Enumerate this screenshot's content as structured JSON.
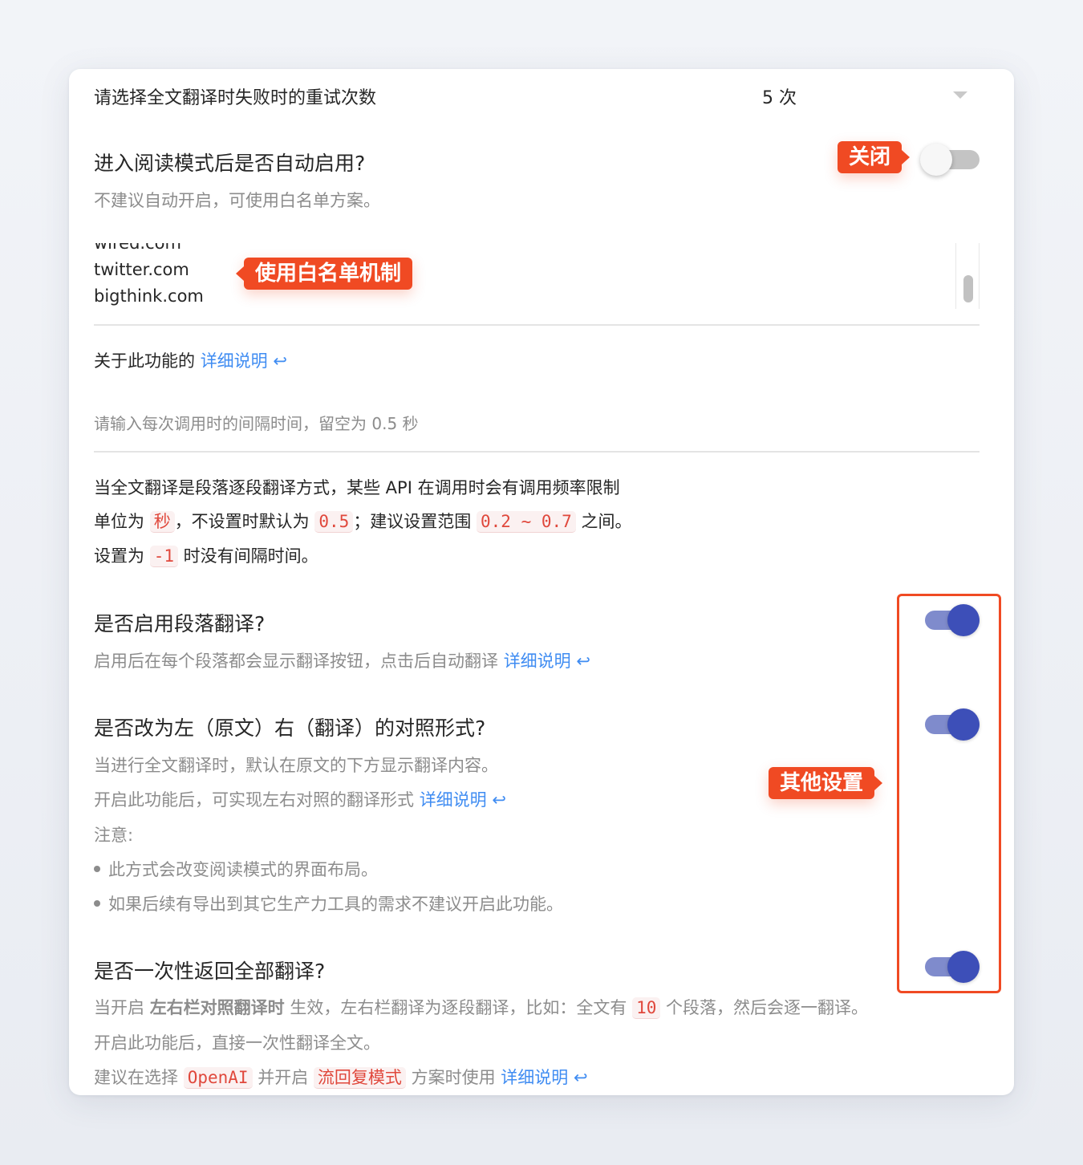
{
  "retry": {
    "label": "请选择全文翻译时失败时的重试次数",
    "value": "5 次"
  },
  "auto_enable": {
    "title": "进入阅读模式后是否自动启用?",
    "desc": "不建议自动开启，可使用白名单方案。",
    "state": "off"
  },
  "whitelist": {
    "items": [
      "wired.com",
      "twitter.com",
      "bigthink.com"
    ]
  },
  "about": {
    "prefix": "关于此功能的",
    "link": "详细说明",
    "arrow": "↩"
  },
  "interval": {
    "placeholder": "请输入每次调用时的间隔时间，留空为 0.5 秒",
    "line1": "当全文翻译是段落逐段翻译方式，某些 API 在调用时会有调用频率限制",
    "line2_a": "单位为",
    "line2_code1": "秒",
    "line2_b": "，不设置时默认为",
    "line2_code2": "0.5",
    "line2_c": "；建议设置范围",
    "line2_code3": "0.2 ~ 0.7",
    "line2_d": "之间。",
    "line3_a": "设置为",
    "line3_code": "-1",
    "line3_b": "时没有间隔时间。"
  },
  "paragraph_translate": {
    "title": "是否启用段落翻译?",
    "desc": "启用后在每个段落都会显示翻译按钮，点击后自动翻译",
    "link": "详细说明",
    "state": "on"
  },
  "side_by_side": {
    "title": "是否改为左（原文）右（翻译）的对照形式?",
    "desc1": "当进行全文翻译时，默认在原文的下方显示翻译内容。",
    "desc2": "开启此功能后，可实现左右对照的翻译形式",
    "link": "详细说明",
    "note_label": "注意:",
    "bullets": [
      "此方式会改变阅读模式的界面布局。",
      "如果后续有导出到其它生产力工具的需求不建议开启此功能。"
    ],
    "state": "on"
  },
  "all_at_once": {
    "title": "是否一次性返回全部翻译?",
    "l1_a": "当开启",
    "l1_bold": "左右栏对照翻译时",
    "l1_b": "生效，左右栏翻译为逐段翻译，比如：全文有",
    "l1_code": "10",
    "l1_c": "个段落，然后会逐一翻译。",
    "l2": "开启此功能后，直接一次性翻译全文。",
    "l3_a": "建议在选择",
    "l3_code1": "OpenAI",
    "l3_b": "并开启",
    "l3_code2": "流回复模式",
    "l3_c": "方案时使用",
    "link": "详细说明",
    "state": "on"
  },
  "callouts": {
    "close": "关闭",
    "whitelist": "使用白名单机制",
    "other": "其他设置"
  },
  "colors": {
    "accent": "#f04a23",
    "link": "#3f8cf2",
    "toggle_on": "#3d4fb8"
  }
}
